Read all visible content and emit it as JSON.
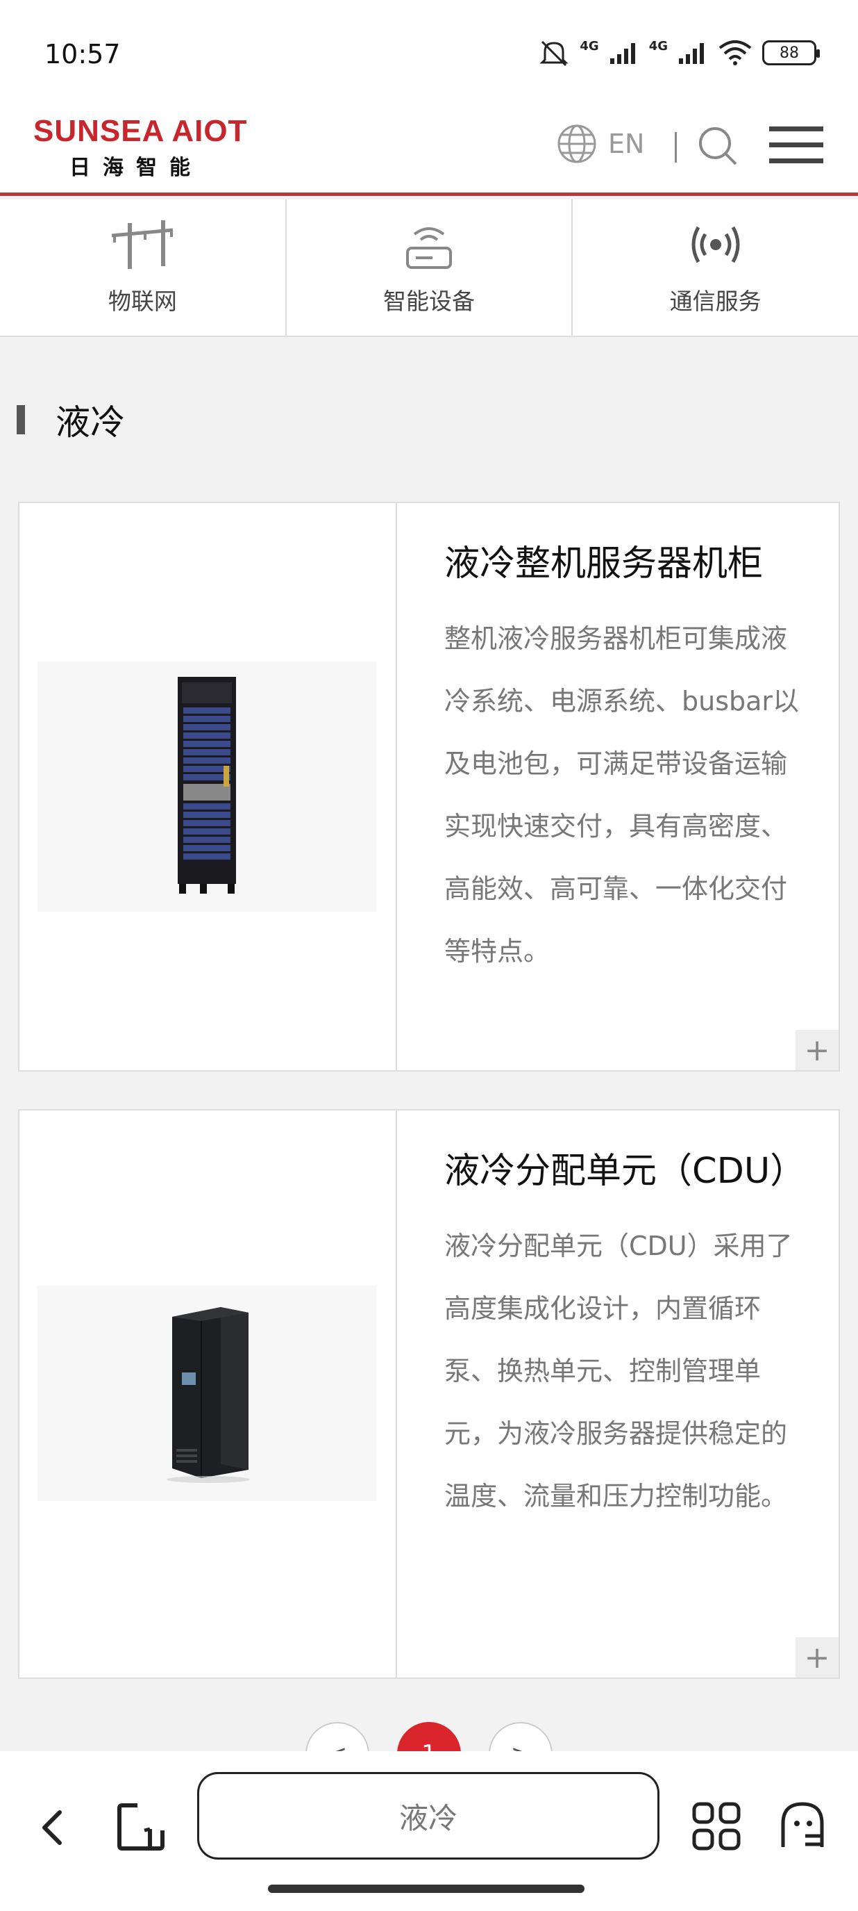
{
  "status_bar": {
    "time": "10:57",
    "network_1": "4G",
    "network_2": "4G",
    "battery": "88"
  },
  "header": {
    "logo_en": "SUNSEA AIOT",
    "logo_cn": "日海智能",
    "lang": "EN",
    "icons": [
      "globe-icon",
      "search-icon",
      "menu-icon"
    ]
  },
  "categories": [
    {
      "label": "物联网",
      "icon": "power-pole-icon"
    },
    {
      "label": "智能设备",
      "icon": "router-icon"
    },
    {
      "label": "通信服务",
      "icon": "broadcast-icon"
    }
  ],
  "section": {
    "title": "液冷"
  },
  "products": [
    {
      "title": "液冷整机服务器机柜",
      "desc": "整机液冷服务器机柜可集成液冷系统、电源系统、busbar以及电池包，可满足带设备运输实现快速交付，具有高密度、高能效、高可靠、一体化交付等特点。",
      "more": "+"
    },
    {
      "title": "液冷分配单元（CDU）",
      "desc": "液冷分配单元（CDU）采用了高度集成化设计，内置循环泵、换热单元、控制管理单元，为液冷服务器提供稳定的温度、流量和压力控制功能。",
      "more": "+"
    }
  ],
  "pagination": {
    "prev": "<",
    "current": "1",
    "next": ">"
  },
  "browser": {
    "address_text": "液冷"
  },
  "colors": {
    "brand_red": "#c8262d",
    "header_line": "#b03a3f",
    "active_page": "#d9252b"
  }
}
